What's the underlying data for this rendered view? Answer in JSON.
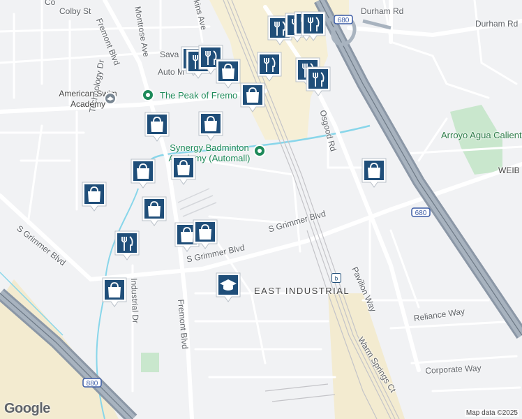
{
  "map": {
    "area_label": "EAST INDUSTRIAL",
    "park_label": "Arroyo Agua Caliente Park",
    "poi_peak": "The Peak of Fremo",
    "poi_synergy": "Synergy Badminton Academy (Automall)",
    "poi_swim": "American Swim Academy",
    "freeway_shield": "680",
    "freeway_shield_south": "880",
    "attribution": "Map data ©2025",
    "logo": "Google"
  },
  "street_labels": {
    "colby": "Colby St",
    "montrose": "Montrose Ave",
    "fremont_north": "Fremont Blvd",
    "fremont_south": "Fremont Blvd",
    "durham_west": "Durham Rd",
    "durham_east": "Durham Rd",
    "osgood": "Osgood Rd",
    "grimmer_east": "S Grimmer Blvd",
    "grimmer_mid": "S Grimmer Blvd",
    "grimmer_west": "S Grimmer Blvd",
    "technology": "Technology Dr",
    "industrial": "Industrial Dr",
    "pavilion": "Pavilion Way",
    "reliance": "Reliance Way",
    "corporate": "Corporate Way",
    "warm_springs": "Warm Springs Ct",
    "weib": "WEIB",
    "auto_mall": "Auto M",
    "sava": "Sava",
    "hopkins": "kins Ave",
    "colfax": "Co"
  },
  "pins": [
    {
      "icon": "fork-knife-icon"
    },
    {
      "icon": "fork-knife-icon"
    },
    {
      "icon": "fork-knife-icon"
    },
    {
      "icon": "fork-knife-icon"
    },
    {
      "icon": "coffee-icon"
    },
    {
      "icon": "fork-knife-icon"
    },
    {
      "icon": "fork-knife-icon"
    },
    {
      "icon": "fork-knife-icon"
    },
    {
      "icon": "fork-knife-icon"
    },
    {
      "icon": "fork-knife-icon"
    },
    {
      "icon": "shopping-bag-icon"
    },
    {
      "icon": "shopping-bag-icon"
    },
    {
      "icon": "shopping-bag-icon"
    },
    {
      "icon": "shopping-bag-icon"
    },
    {
      "icon": "shopping-bag-icon"
    },
    {
      "icon": "shopping-bag-icon"
    },
    {
      "icon": "shopping-bag-icon"
    },
    {
      "icon": "shopping-bag-icon"
    },
    {
      "icon": "shopping-bag-icon"
    },
    {
      "icon": "shopping-bag-icon"
    },
    {
      "icon": "shopping-bag-icon"
    },
    {
      "icon": "shopping-bag-icon"
    },
    {
      "icon": "fork-knife-icon"
    },
    {
      "icon": "graduation-cap-icon"
    }
  ],
  "colors": {
    "pin_fill": "#1f4e79",
    "freeway": "#8e9aa8",
    "water": "#7fd3e8",
    "park": "#c8e6c9",
    "commercial": "#f4ecd0"
  }
}
